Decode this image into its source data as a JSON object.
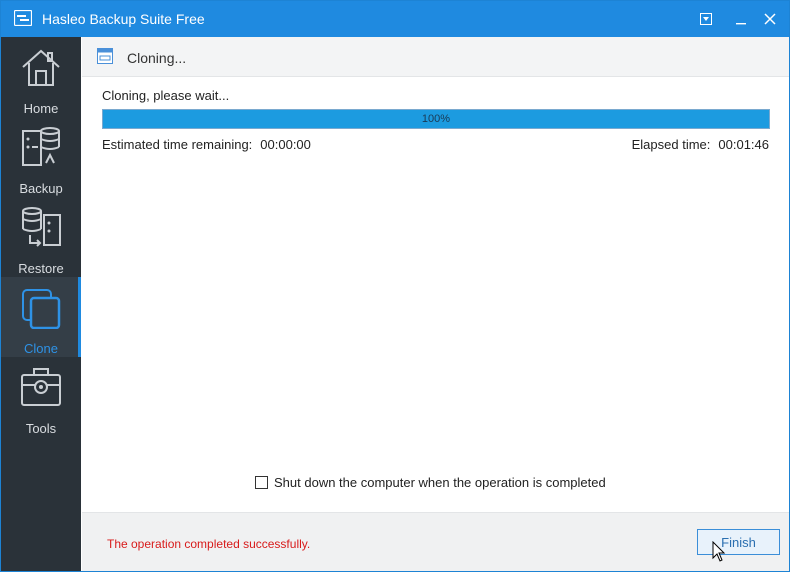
{
  "window": {
    "title": "Hasleo Backup Suite Free",
    "accent_color": "#1f8ae0"
  },
  "sidebar": {
    "items": [
      {
        "label": "Home",
        "icon": "home-icon",
        "active": false
      },
      {
        "label": "Backup",
        "icon": "backup-icon",
        "active": false
      },
      {
        "label": "Restore",
        "icon": "restore-icon",
        "active": false
      },
      {
        "label": "Clone",
        "icon": "clone-icon",
        "active": true
      },
      {
        "label": "Tools",
        "icon": "tools-icon",
        "active": false
      }
    ]
  },
  "main": {
    "header_title": "Cloning...",
    "status_text": "Cloning, please wait...",
    "progress": {
      "value": 100,
      "label": "100%"
    },
    "estimated_label": "Estimated time remaining:",
    "estimated_value": "00:00:00",
    "elapsed_label": "Elapsed time:",
    "elapsed_value": "00:01:46",
    "shutdown_label": "Shut down the computer when the operation is completed",
    "shutdown_checked": false
  },
  "footer": {
    "message": "The operation completed successfully.",
    "message_color": "#d81b1b",
    "finish_label": "Finish"
  }
}
